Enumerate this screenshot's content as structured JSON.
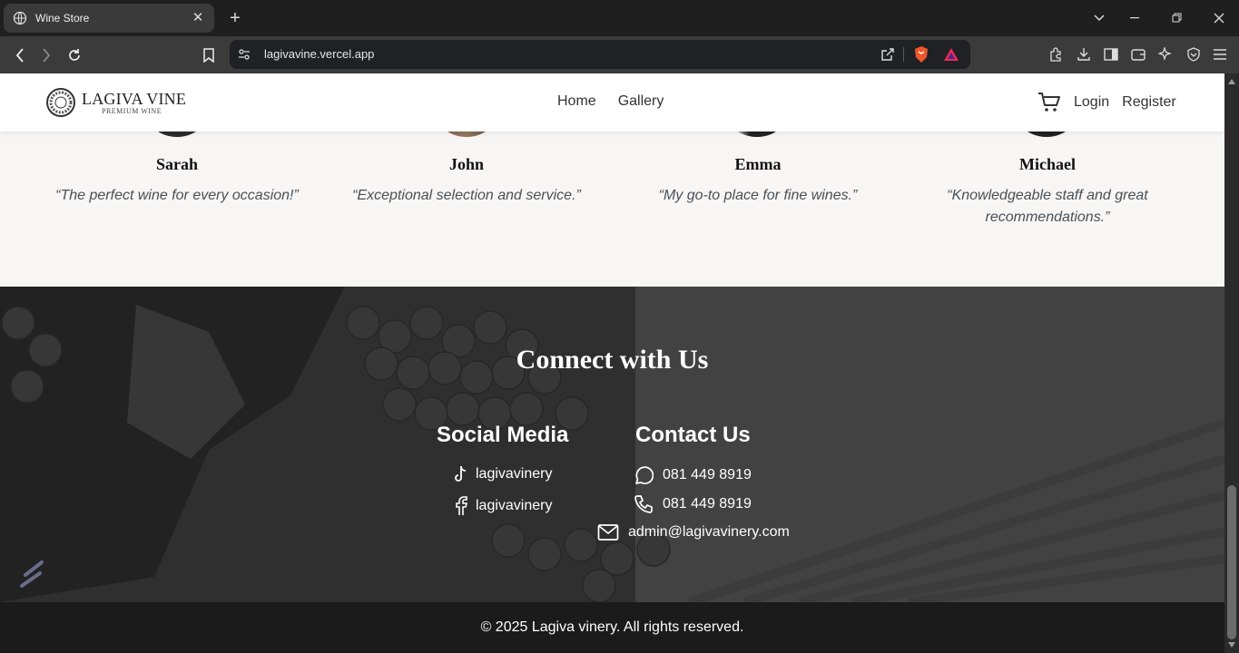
{
  "browser": {
    "tab_title": "Wine Store",
    "url": "lagivavine.vercel.app"
  },
  "header": {
    "logo_text": "LAGIVA VINE",
    "logo_sub": "PREMIUM WINE",
    "nav": [
      "Home",
      "Gallery"
    ],
    "login": "Login",
    "register": "Register"
  },
  "testimonials": [
    {
      "name": "Sarah",
      "quote": "“The perfect wine for every occasion!”"
    },
    {
      "name": "John",
      "quote": "“Exceptional selection and service.”"
    },
    {
      "name": "Emma",
      "quote": "“My go-to place for fine wines.”"
    },
    {
      "name": "Michael",
      "quote": "“Knowledgeable staff and great recommendations.”"
    }
  ],
  "connect": {
    "title": "Connect with Us",
    "social_title": "Social Media",
    "social": [
      {
        "icon": "tiktok-icon",
        "label": "lagivavinery"
      },
      {
        "icon": "facebook-icon",
        "label": "lagivavinery"
      }
    ],
    "contact_title": "Contact Us",
    "contact": [
      {
        "icon": "whatsapp-icon",
        "label": "081 449 8919"
      },
      {
        "icon": "phone-icon",
        "label": "081 449 8919"
      },
      {
        "icon": "mail-icon",
        "label": "admin@lagivavinery.com"
      }
    ]
  },
  "footer": {
    "copyright": "© 2025 Lagiva vinery. All rights reserved."
  }
}
